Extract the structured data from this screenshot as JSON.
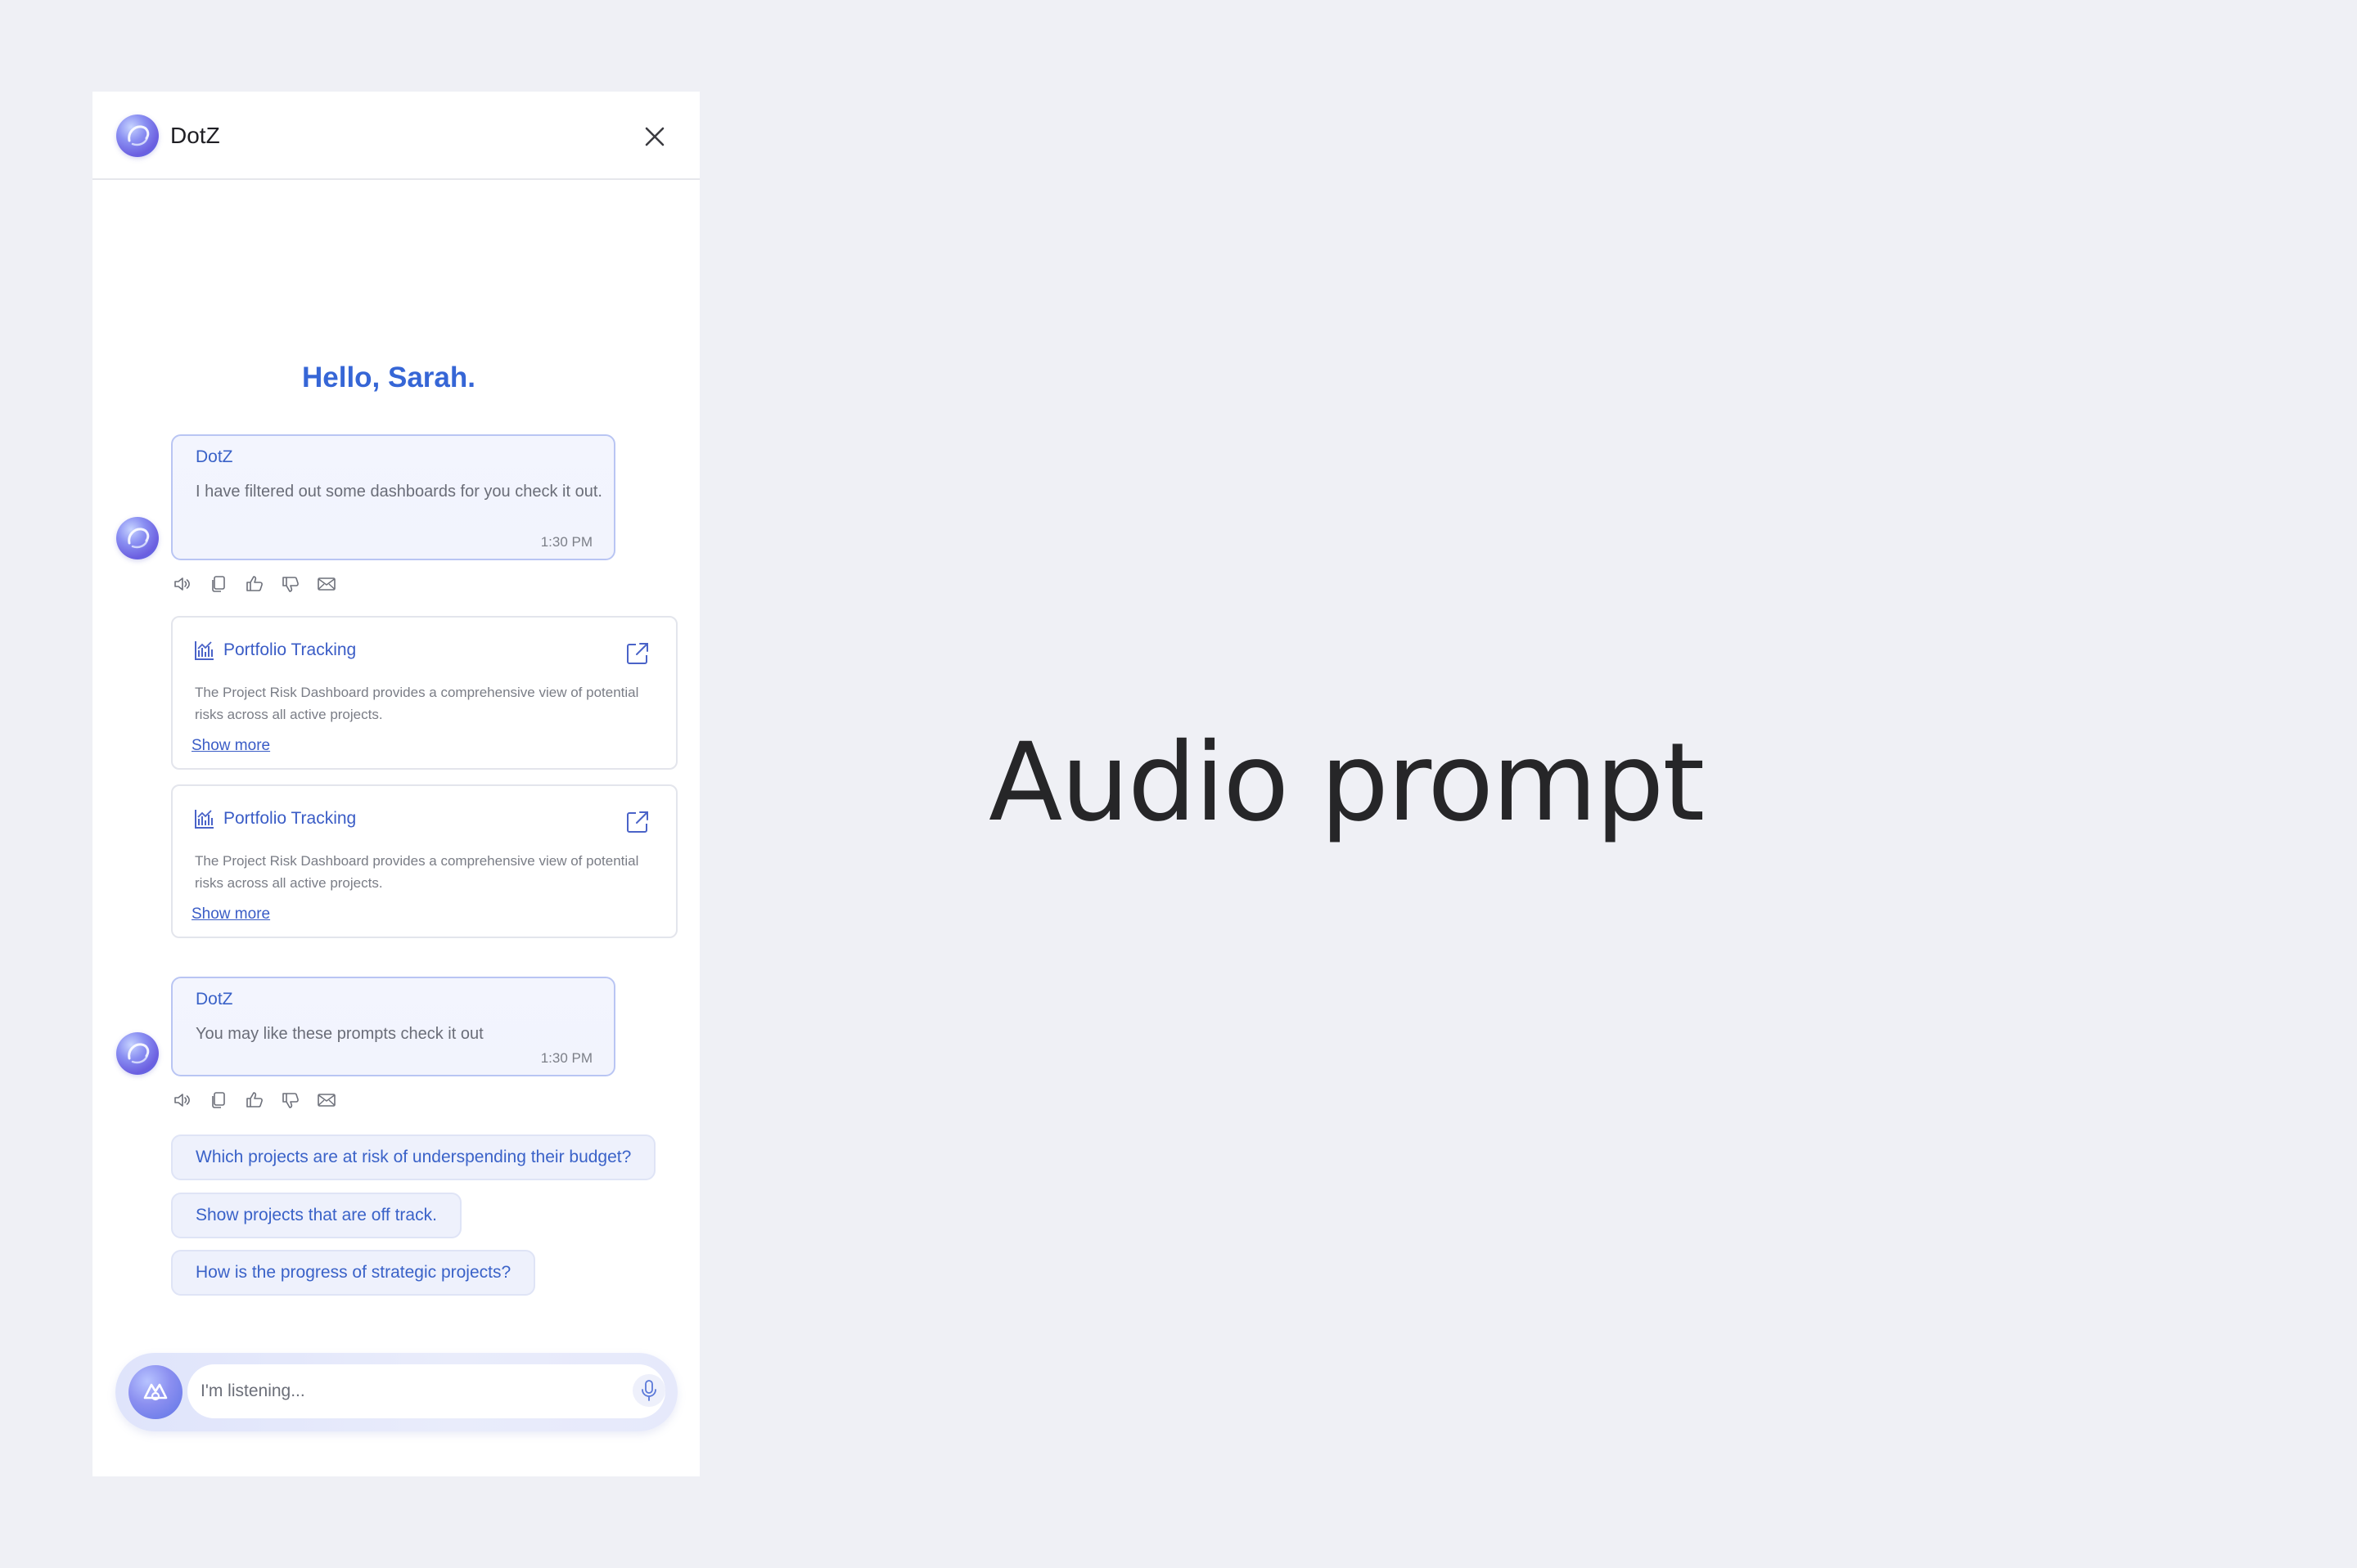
{
  "header": {
    "title": "DotZ"
  },
  "greeting": "Hello, Sarah.",
  "messages": [
    {
      "sender": "DotZ",
      "text": "I have filtered out some dashboards for you check it out.",
      "time": "1:30 PM"
    },
    {
      "sender": "DotZ",
      "text": "You may like these prompts check it out",
      "time": "1:30 PM"
    }
  ],
  "message_actions": [
    "speaker-icon",
    "copy-icon",
    "thumbs-up-icon",
    "thumbs-down-icon",
    "mail-icon"
  ],
  "cards": [
    {
      "title": "Portfolio Tracking",
      "description": "The Project Risk Dashboard provides a comprehensive view of potential risks across all active projects.",
      "link": "Show more",
      "icon": "chart-icon"
    },
    {
      "title": "Portfolio Tracking",
      "description": "The Project Risk Dashboard provides a comprehensive view of potential risks across all active projects.",
      "link": "Show more",
      "icon": "chart-icon"
    }
  ],
  "suggestions": [
    "Which projects are at risk of underspending their budget?",
    "Show projects that are off track.",
    "How is the progress of strategic projects?"
  ],
  "input": {
    "placeholder": "I'm listening..."
  },
  "caption": "Audio prompt",
  "colors": {
    "accent": "#3a62c8",
    "background": "#eff0f5",
    "bubble": "#f2f4fd",
    "bubble_border": "#b9c5f3"
  }
}
